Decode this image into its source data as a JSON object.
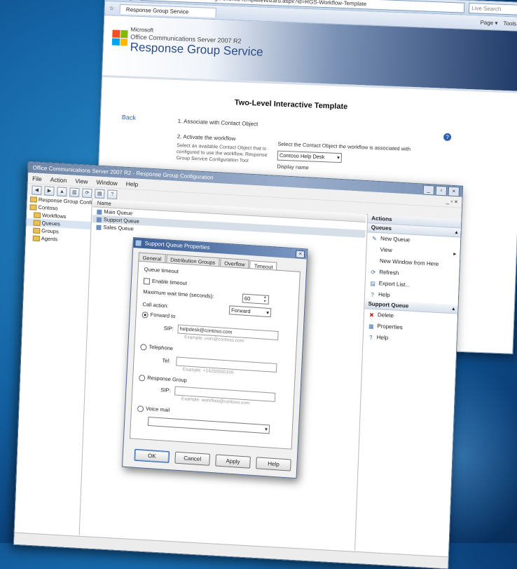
{
  "browser": {
    "address": "http://ocs-rgs.contoso.com/Rgs/Clients/TemplateWizard.aspx?id=RGS-Workflow-Template",
    "search_placeholder": "Live Search",
    "tab_label": "Response Group Service",
    "toolbar": [
      "Page ▾",
      "Tools ▾"
    ],
    "brand_line1": "Microsoft",
    "brand_line2": "Office Communications Server 2007 R2",
    "brand_line3": "Response Group Service",
    "template_title": "Two-Level Interactive Template",
    "back_link": "Back",
    "step1": "1. Associate with Contact Object",
    "step2": "2. Activate the workflow",
    "step2_desc": "Select an available Contact Object that is configured to use the workflow. Response Group Service Configuration Tool",
    "right_text": "Select the Contact Object the workflow is associated with",
    "select_value": "Contoso Help Desk",
    "display_name_label": "Display name"
  },
  "mmc": {
    "title": "Office Communications Server 2007 R2 - Response Group Configuration",
    "menu": [
      "File",
      "Action",
      "View",
      "Window",
      "Help"
    ],
    "inner_ctrl": "_ ▫ ×",
    "tree": [
      {
        "label": "Response Group Configuration",
        "level": 0
      },
      {
        "label": "Contoso",
        "level": 0
      },
      {
        "label": "Workflows",
        "level": 1
      },
      {
        "label": "Queues",
        "level": 1
      },
      {
        "label": "Groups",
        "level": 1
      },
      {
        "label": "Agents",
        "level": 1
      }
    ],
    "list_header": "Name",
    "list_items": [
      "Main Queue",
      "Support Queue",
      "Sales Queue"
    ],
    "actions_title": "Actions",
    "queues_section": "Queues",
    "queue_actions": [
      {
        "icon": "new-queue-icon",
        "glyph": "✎",
        "label": "New Queue",
        "submenu": false
      },
      {
        "icon": "view-icon",
        "glyph": "",
        "label": "View",
        "submenu": true
      },
      {
        "icon": "new-window-icon",
        "glyph": "",
        "label": "New Window from Here",
        "submenu": false
      },
      {
        "icon": "refresh-icon",
        "glyph": "⟳",
        "label": "Refresh",
        "submenu": false
      },
      {
        "icon": "export-list-icon",
        "glyph": "▤",
        "label": "Export List...",
        "submenu": false
      },
      {
        "icon": "help-icon",
        "glyph": "?",
        "label": "Help",
        "submenu": false
      }
    ],
    "selected_section": "Support Queue",
    "selected_actions": [
      {
        "icon": "delete-icon",
        "glyph": "✖",
        "label": "Delete",
        "color": "#d02020"
      },
      {
        "icon": "properties-icon",
        "glyph": "▦",
        "label": "Properties",
        "color": "#3a6bb0"
      },
      {
        "icon": "help-icon",
        "glyph": "?",
        "label": "Help",
        "color": "#3a6bb0"
      }
    ]
  },
  "dialog": {
    "title": "Support Queue Properties",
    "close": "×",
    "tabs": [
      "General",
      "Distribution Groups",
      "Overflow",
      "Timeout"
    ],
    "active_tab": "Timeout",
    "section_label": "Queue timeout",
    "enable_timeout": "Enable timeout",
    "timeout_seconds_label": "Maximum wait time (seconds):",
    "timeout_seconds": "60",
    "action_label": "Call action:",
    "action_value": "Forward",
    "forward_option": "Forward to",
    "sip_label": "SIP:",
    "sip_value": "helpdesk@contoso.com",
    "sip_hint": "Example: user@contoso.com",
    "tel_option": "Telephone",
    "tel_label": "Tel:",
    "tel_hint": "Example: +14255550100",
    "question_option": "Response Group",
    "question_label": "SIP:",
    "question_hint": "Example: workflow@contoso.com",
    "voicemail_option": "Voice mail",
    "voicemail_value": "",
    "buttons": [
      "OK",
      "Cancel",
      "Apply",
      "Help"
    ]
  }
}
